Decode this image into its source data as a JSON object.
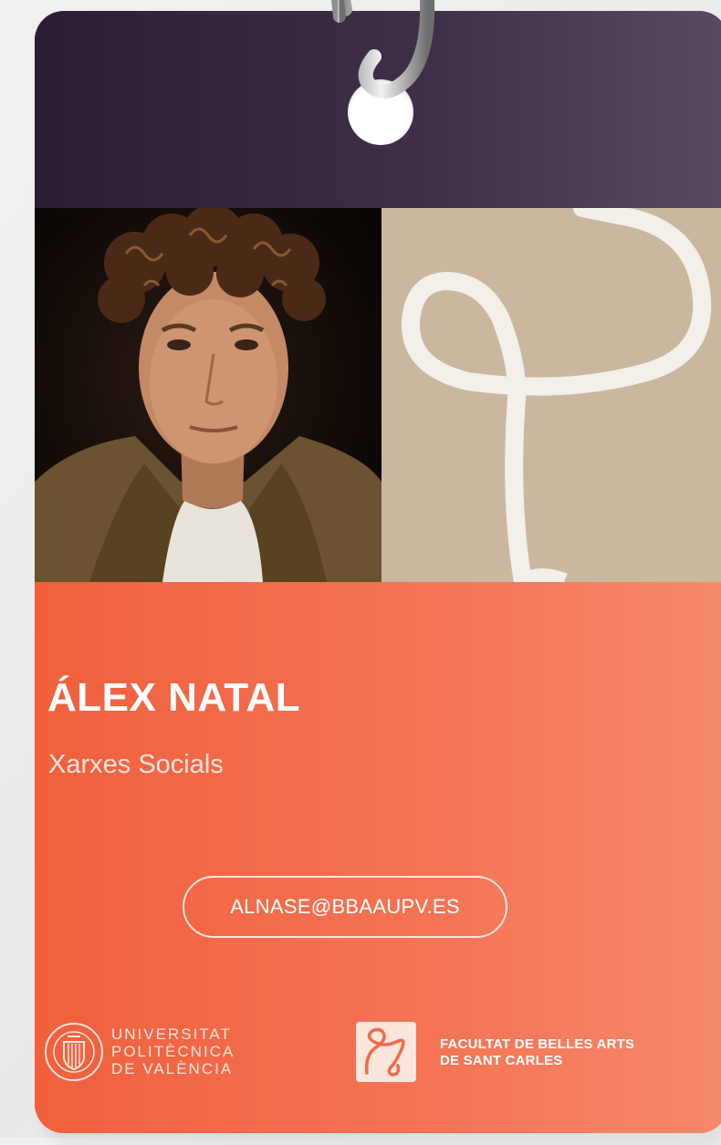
{
  "badge": {
    "name": "ÁLEX NATAL",
    "department": "Xarxes Socials",
    "email": "ALNASE@BBAAUPV.ES"
  },
  "logos": {
    "university_lines": [
      "UNIVERSITAT",
      "POLITÈCNICA",
      "DE VALÈNCIA"
    ],
    "faculty_lines": [
      "FACULTAT DE BELLES ARTS",
      "DE SANT CARLES"
    ]
  },
  "colors": {
    "top_band": "#2c1d34",
    "accent_orange": "#f26a47",
    "pattern_beige": "#c9b7a0",
    "text_light": "#ffe4dc"
  }
}
